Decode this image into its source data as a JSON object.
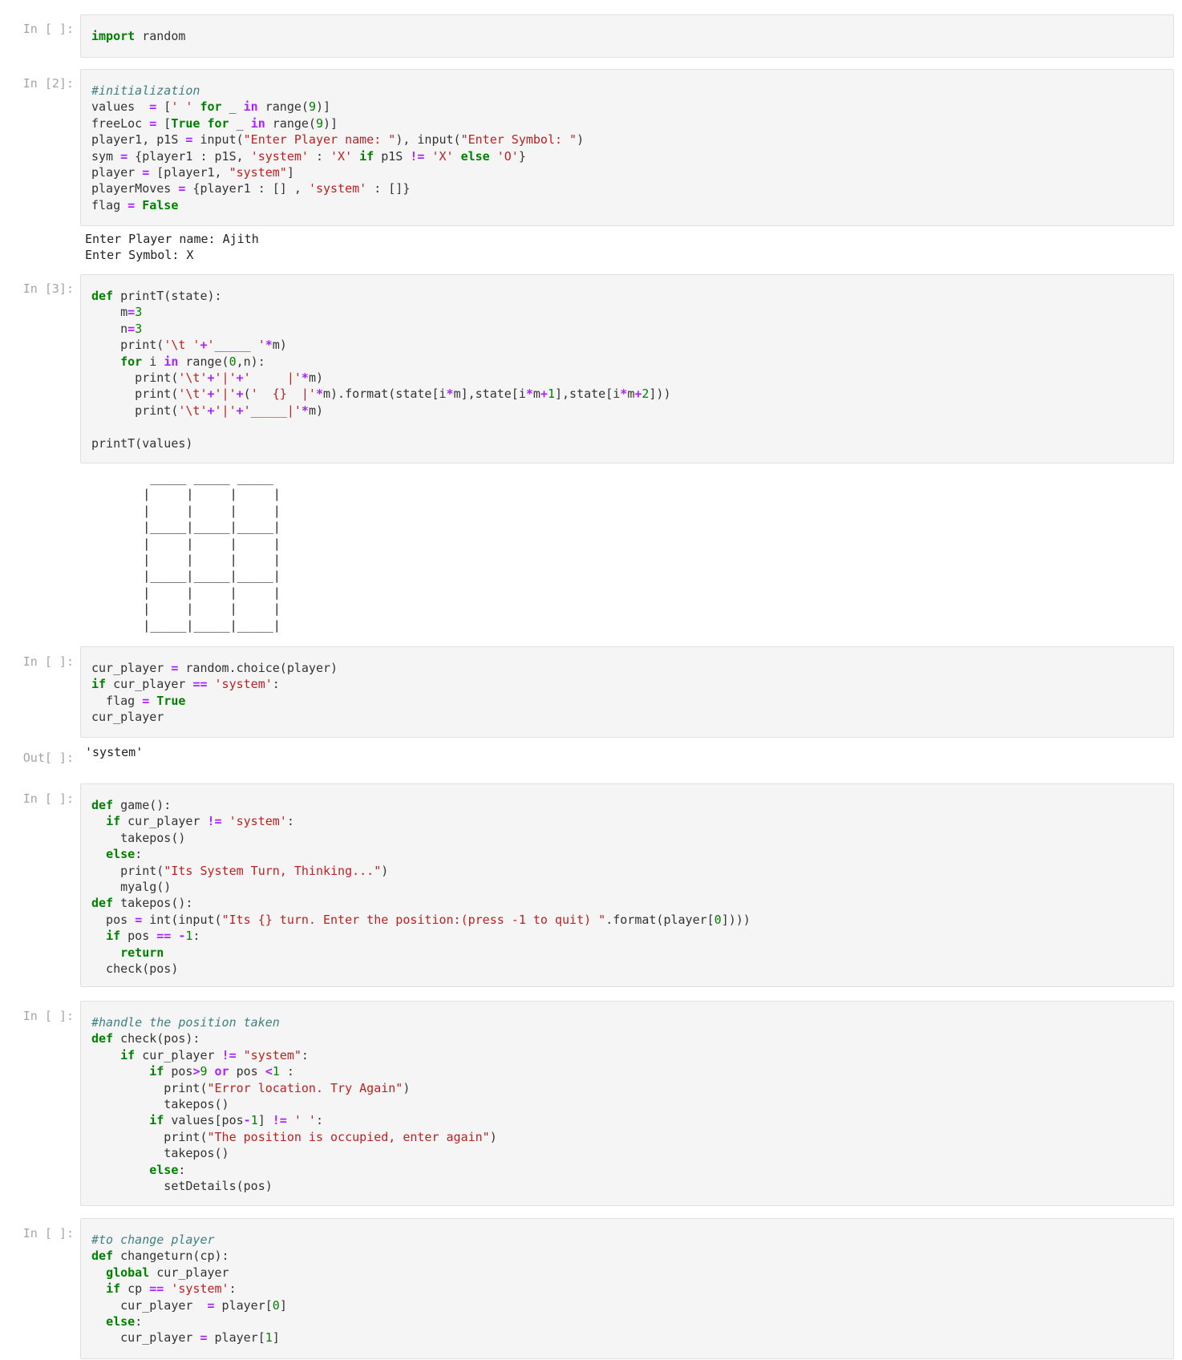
{
  "prompts": {
    "c1": "In [ ]:",
    "c2": "In [2]:",
    "c3": "In [3]:",
    "c4": "In [ ]:",
    "c4_out": "Out[ ]:",
    "c5": "In [ ]:",
    "c6": "In [ ]:",
    "c7": "In [ ]:"
  },
  "cells": [
    {
      "prompt": "In [ ]:",
      "code": "import random"
    },
    {
      "prompt": "In [2]:",
      "code": "#initialization\nvalues  = [' ' for _ in range(9)]\nfreeLoc = [True for _ in range(9)]\nplayer1, p1S = input(\"Enter Player name: \"), input(\"Enter Symbol: \")\nsym = {player1 : p1S, 'system' : 'X' if p1S != 'X' else 'O'}\nplayer = [player1, \"system\"]\nplayerMoves = {player1 : [] , 'system' : []}\nflag = False",
      "output": "Enter Player name: Ajith\nEnter Symbol: X"
    },
    {
      "prompt": "In [3]:",
      "code": "def printT(state):\n    m=3\n    n=3\n    print('\\t '+'_____ '*m)\n    for i in range(0,n):\n      print('\\t'+'|'+'     |'*m)\n      print('\\t'+'|'+('  {}  |'*m).format(state[i*m],state[i*m+1],state[i*m+2]))\n      print('\\t'+'|'+'_____|'*m)\n\nprintT(values)"
    },
    {
      "prompt": "In [ ]:",
      "code": "cur_player = random.choice(player)\nif cur_player == 'system':\n  flag = True\ncur_player",
      "out_prompt": "Out[ ]:",
      "output": "'system'"
    },
    {
      "prompt": "In [ ]:",
      "code": "def game():\n  if cur_player != 'system':\n    takepos()\n  else:\n    print(\"Its System Turn, Thinking...\")\n    myalg()\ndef takepos():\n  pos = int(input(\"Its {} turn. Enter the position:(press -1 to quit) \".format(player[0])))\n  if pos == -1:\n    return\n  check(pos)"
    },
    {
      "prompt": "In [ ]:",
      "code": "#handle the position taken\ndef check(pos):\n    if cur_player != \"system\":\n        if pos>9 or pos <1 :\n          print(\"Error location. Try Again\")\n          takepos()\n        if values[pos-1] != ' ':\n          print(\"The position is occupied, enter again\")\n          takepos()\n        else:\n          setDetails(pos)"
    },
    {
      "prompt": "In [ ]:",
      "code": "#to change player\ndef changeturn(cp):\n  global cur_player\n  if cp == 'system':\n    cur_player  = player[0]\n  else:\n    cur_player = player[1]"
    }
  ],
  "outputs": {
    "input_echo_1": "Enter Player name: Ajith",
    "input_echo_2": "Enter Symbol: X",
    "board": "         _____ _____ _____\n        |     |     |     |\n        |     |     |     |\n        |_____|_____|_____|\n        |     |     |     |\n        |     |     |     |\n        |_____|_____|_____|\n        |     |     |     |\n        |     |     |     |\n        |_____|_____|_____|",
    "cur_player_value": "'system'"
  }
}
